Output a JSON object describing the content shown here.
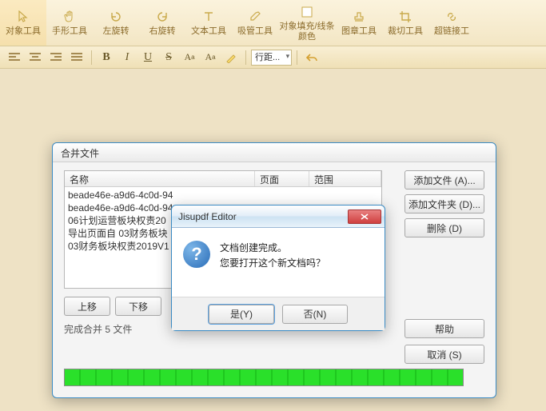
{
  "ribbon": {
    "items": [
      {
        "label": "对象工具",
        "icon": "cursor"
      },
      {
        "label": "手形工具",
        "icon": "hand"
      },
      {
        "label": "左旋转",
        "icon": "rotate-left"
      },
      {
        "label": "右旋转",
        "icon": "rotate-right"
      },
      {
        "label": "文本工具",
        "icon": "text"
      },
      {
        "label": "吸管工具",
        "icon": "eyedropper"
      },
      {
        "label": "对象填充/线条颜色",
        "icon": "fill"
      },
      {
        "label": "图章工具",
        "icon": "stamp"
      },
      {
        "label": "裁切工具",
        "icon": "crop"
      },
      {
        "label": "超链接工",
        "icon": "link"
      }
    ]
  },
  "format_bar": {
    "combo": "行距..."
  },
  "merge_dialog": {
    "title": "合并文件",
    "columns": {
      "name": "名称",
      "page": "页面",
      "range": "范围"
    },
    "files": [
      "beade46e-a9d6-4c0d-94",
      "beade46e-a9d6-4c0d-94",
      "06计划运营板块权责20",
      "导出页面自 03财务板块",
      "03财务板块权责2019V1"
    ],
    "buttons": {
      "add_file": "添加文件 (A)...",
      "add_folder": "添加文件夹 (D)...",
      "delete": "删除 (D)",
      "move_up": "上移",
      "move_down": "下移",
      "help": "帮助",
      "cancel": "取消 (S)"
    },
    "status": "完成合并 5 文件",
    "progress_percent": 100
  },
  "message_box": {
    "title": "Jisupdf Editor",
    "line1": "文档创建完成。",
    "line2": "您要打开这个新文档吗？",
    "yes": "是(Y)",
    "no": "否(N)"
  }
}
